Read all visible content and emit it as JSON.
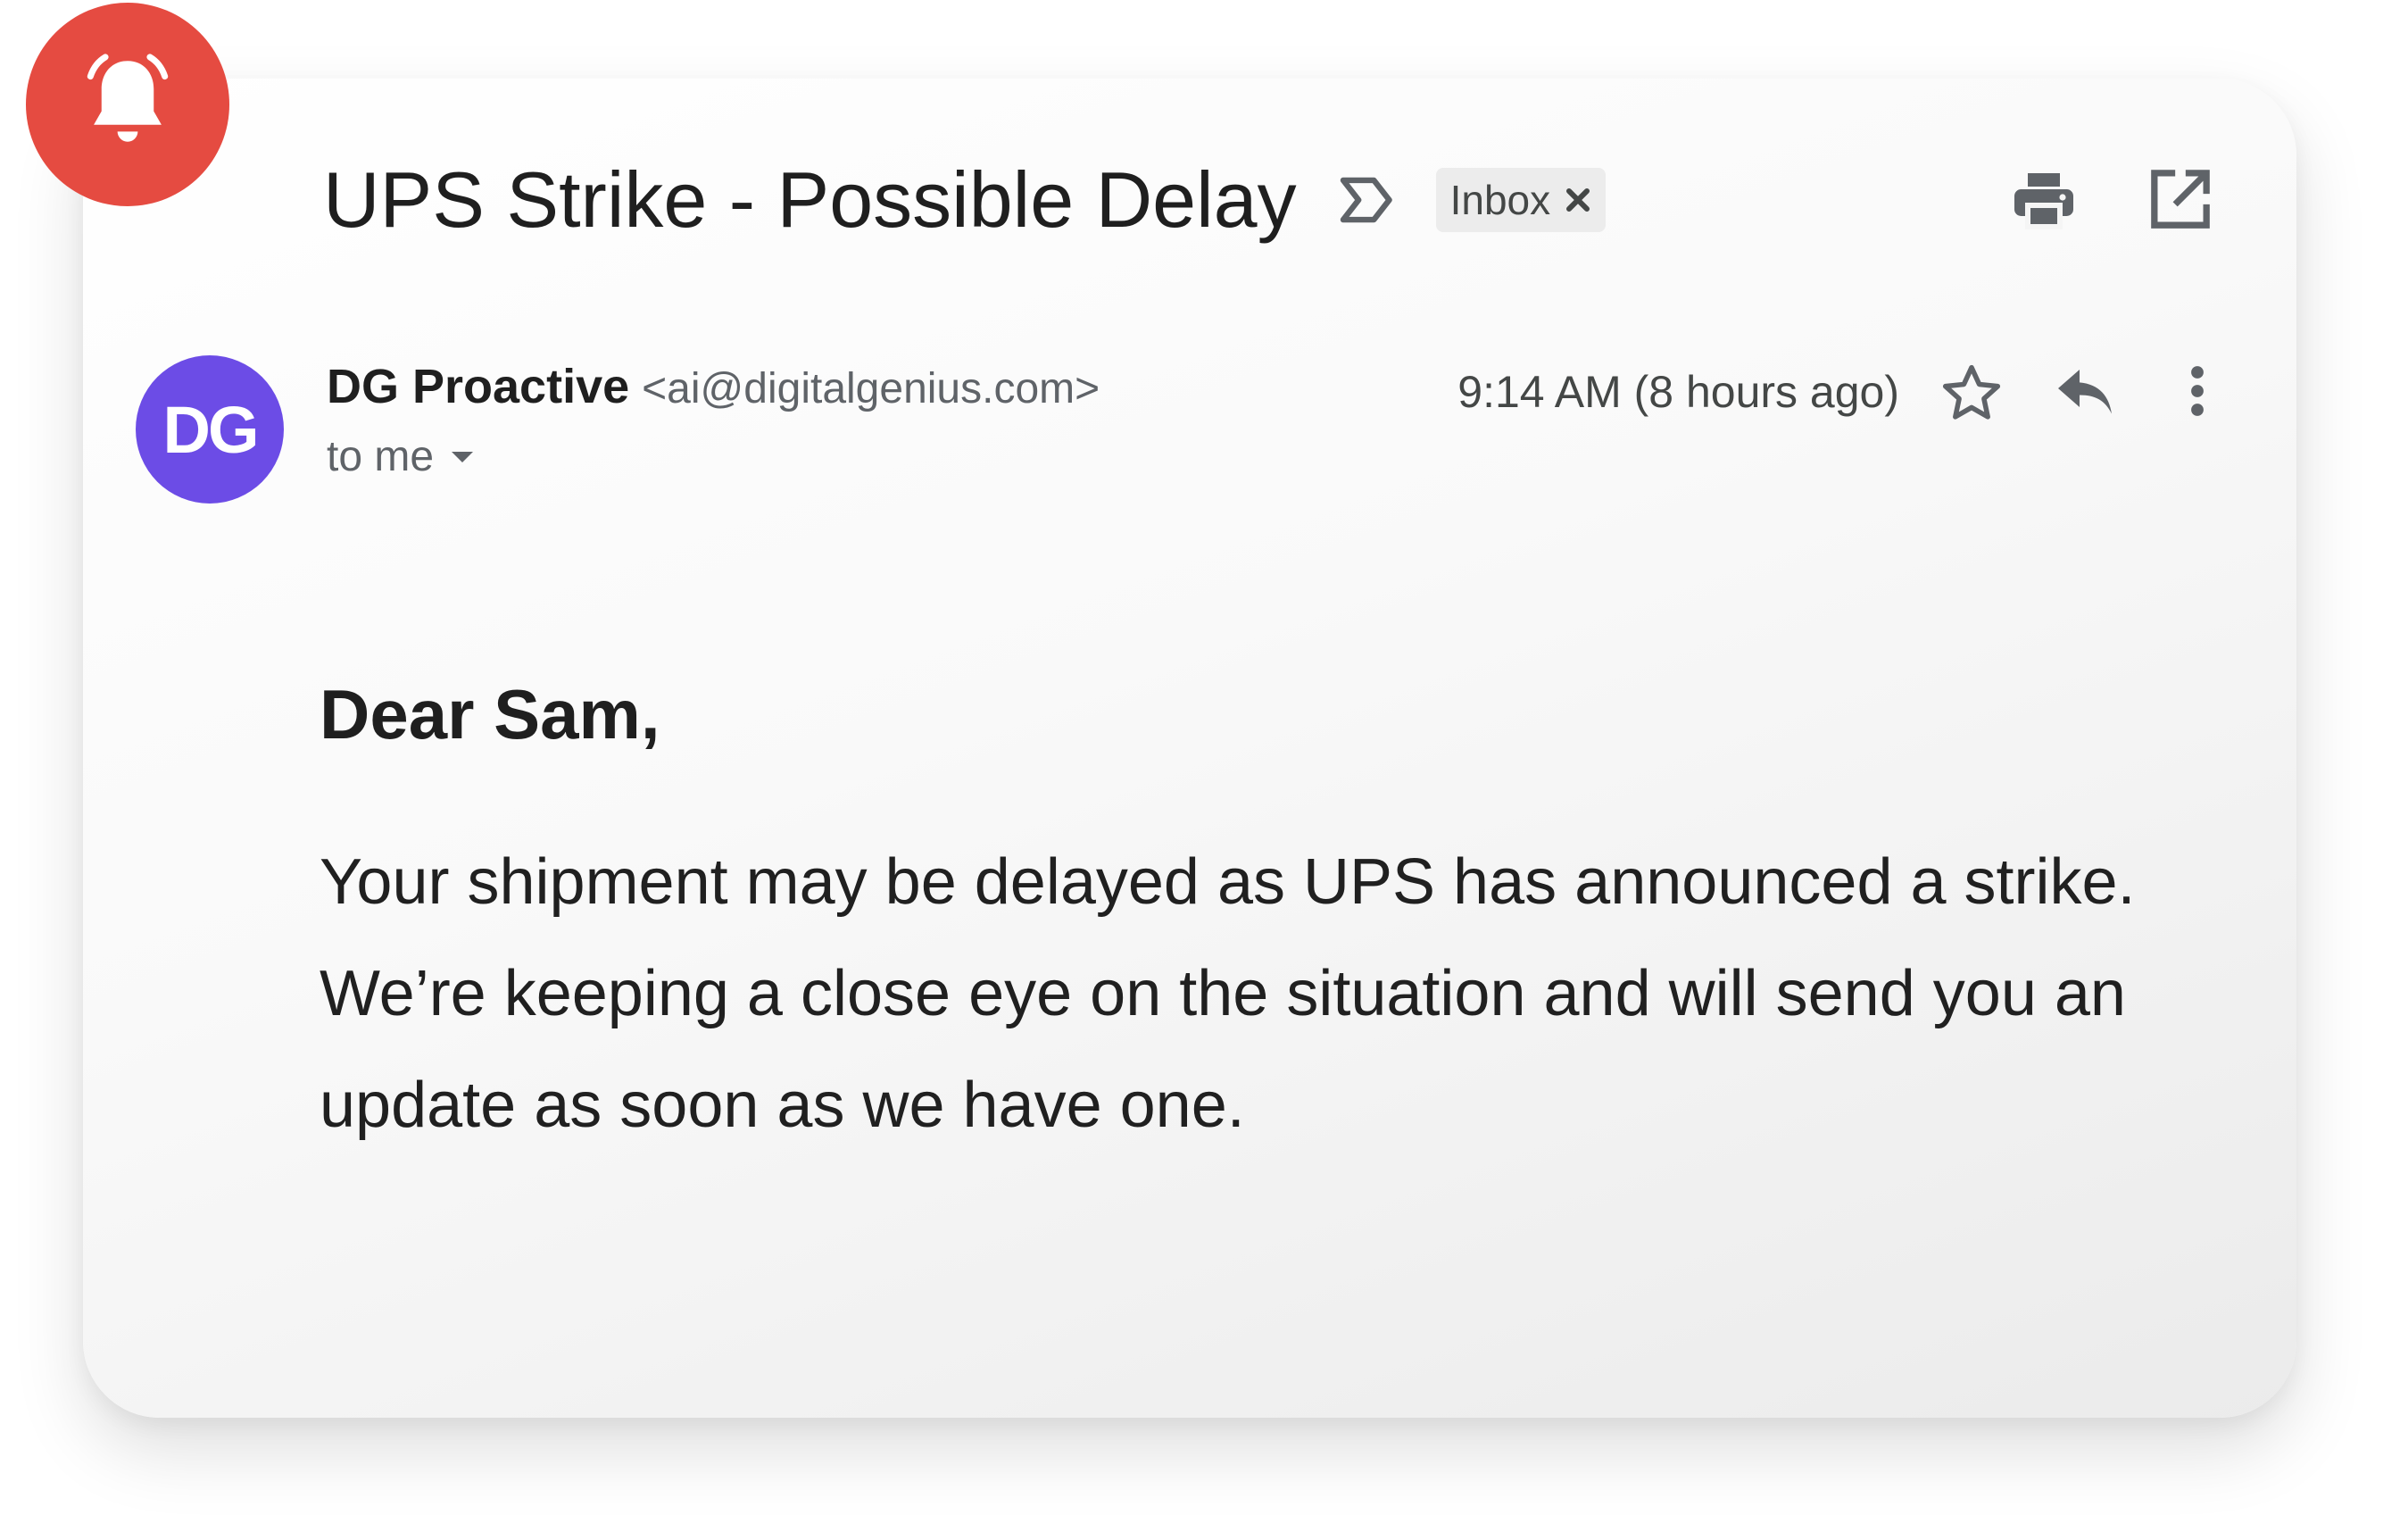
{
  "email": {
    "subject": "UPS Strike - Possible Delay",
    "label_chip": "Inbox",
    "sender_name": "DG Proactive",
    "sender_email": "<ai@digitalgenius.com>",
    "avatar_initials": "DG",
    "recipient": "to me",
    "timestamp": "9:14 AM (8 hours ago)",
    "greeting": "Dear Sam,",
    "body": "Your shipment may be delayed as UPS has announced a strike. We’re keeping a close eye on the situation and will send you an update as soon as we have one."
  },
  "icons": {
    "badge": "bell-icon",
    "importance": "importance-marker-icon",
    "chip_close": "close-icon",
    "print": "print-icon",
    "new_window": "open-in-new-window-icon",
    "recipient_details": "caret-down-icon",
    "star": "star-icon",
    "reply": "reply-icon",
    "more": "more-vertical-icon"
  },
  "colors": {
    "badge_background": "#e54b41",
    "avatar_background": "#6c4ce6",
    "card_background": "#f7f7f7",
    "text_primary": "#1f1f1f",
    "text_secondary": "#5f6368"
  }
}
